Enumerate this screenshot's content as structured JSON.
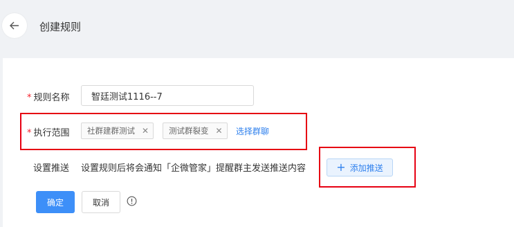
{
  "header": {
    "title": "创建规则",
    "back_icon": "arrow-left-icon"
  },
  "form": {
    "name": {
      "label": "规则名称",
      "required": true,
      "value": "智廷测试1116--7"
    },
    "scope": {
      "label": "执行范围",
      "required": true,
      "tags": [
        {
          "label": "社群建群测试"
        },
        {
          "label": "测试群裂变"
        }
      ],
      "select_link": "选择群聊"
    },
    "push": {
      "label": "设置推送",
      "hint": "设置规则后将会通知「企微管家」提醒群主发送推送内容",
      "add_button": "添加推送"
    }
  },
  "actions": {
    "confirm": "确定",
    "cancel": "取消",
    "info_icon": "info-circle-icon"
  },
  "colors": {
    "primary": "#3d8ff8",
    "required": "#f5222d",
    "highlight": "#e60012"
  }
}
